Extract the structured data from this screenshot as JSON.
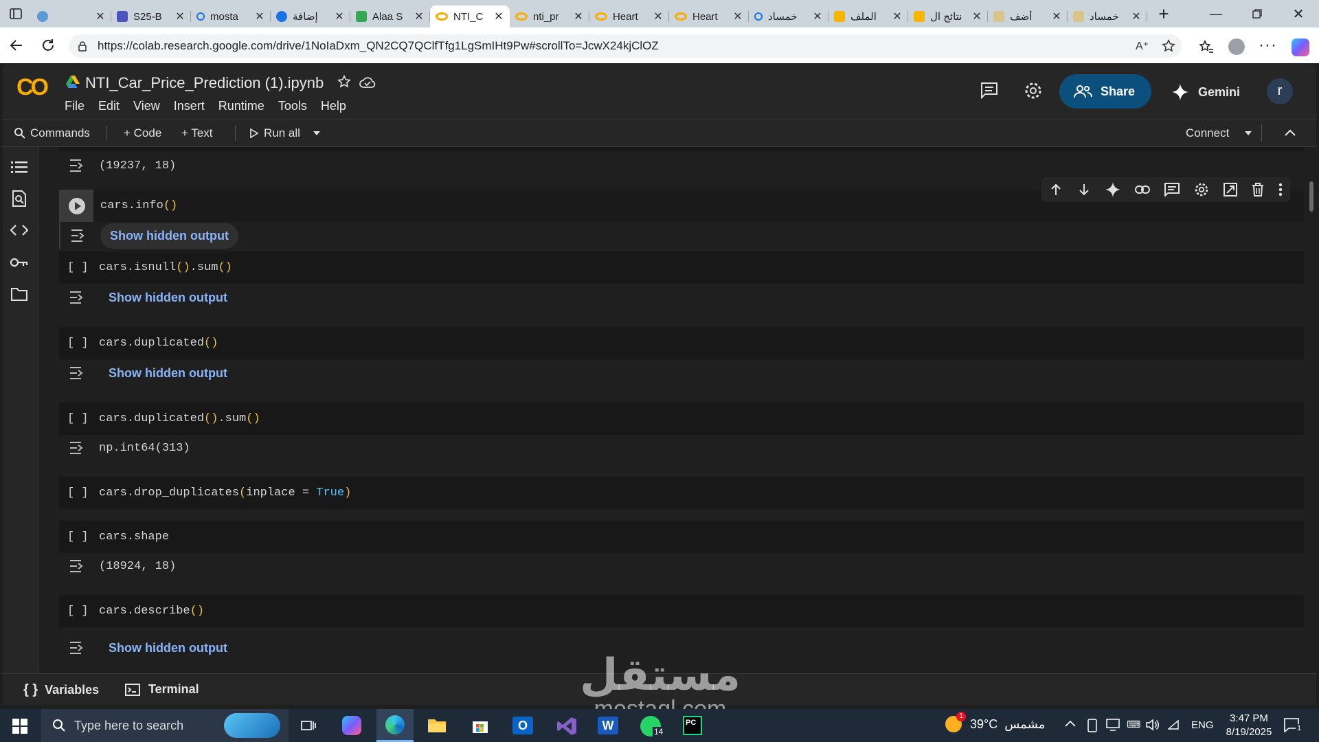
{
  "browser": {
    "tabs": [
      {
        "label": "",
        "favicon": "blue-circle-icon",
        "color": "#5b9bd5"
      },
      {
        "label": "S25-B",
        "favicon": "teams-icon",
        "color": "#4b53bc"
      },
      {
        "label": "mosta",
        "favicon": "search-icon",
        "color": "#1a73e8"
      },
      {
        "label": "إضافة",
        "favicon": "blue-circle-icon",
        "color": "#1a73e8"
      },
      {
        "label": "Alaa S",
        "favicon": "google-drive-icon",
        "color": "#34a853"
      },
      {
        "label": "NTI_C",
        "favicon": "colab-icon",
        "color": "#f9ab00",
        "active": true
      },
      {
        "label": "nti_pr",
        "favicon": "colab-icon",
        "color": "#f9ab00"
      },
      {
        "label": "Heart",
        "favicon": "colab-icon",
        "color": "#f9ab00"
      },
      {
        "label": "Heart",
        "favicon": "colab-icon",
        "color": "#f9ab00"
      },
      {
        "label": "خمساد",
        "favicon": "search-icon",
        "color": "#1a73e8"
      },
      {
        "label": "الملف",
        "favicon": "number-5-icon",
        "color": "#f6b500"
      },
      {
        "label": "نتائج ال",
        "favicon": "number-5-icon",
        "color": "#f6b500"
      },
      {
        "label": "أضف",
        "favicon": "number-5-icon",
        "color": "#d9c48a"
      },
      {
        "label": "خمساد",
        "favicon": "number-5-icon",
        "color": "#d9c48a"
      }
    ],
    "url": "https://colab.research.google.com/drive/1NoIaDxm_QN2CQ7QClfTfg1LgSmIHt9Pw#scrollTo=JcwX24kjClOZ"
  },
  "colab": {
    "logo": "CO",
    "notebook_title": "NTI_Car_Price_Prediction (1).ipynb",
    "menu": [
      "File",
      "Edit",
      "View",
      "Insert",
      "Runtime",
      "Tools",
      "Help"
    ],
    "share_label": "Share",
    "gemini_label": "Gemini",
    "avatar_letter": "r",
    "toolbar": {
      "commands": "Commands",
      "code": "+ Code",
      "text": "+ Text",
      "run_all": "Run all",
      "connect": "Connect"
    },
    "bottom": {
      "variables": "Variables",
      "terminal": "Terminal"
    },
    "colors": {
      "accent": "#8ab4f8",
      "share_bg": "#0b4f7c",
      "paren": "#f0c23b",
      "keyword": "#4fc1ff"
    }
  },
  "cells": {
    "c0_out": "(19237, 18)",
    "c1_code": "cars.info()",
    "c2_code": "cars.isnull().sum()",
    "c3_code": "cars.duplicated()",
    "c4_code": "cars.duplicated().sum()",
    "c4_out": "np.int64(313)",
    "c5_code": "cars.drop_duplicates(inplace = True)",
    "c6_code": "cars.shape",
    "c6_out": "(18924, 18)",
    "c7_code": "cars.describe()",
    "bracket": "[ ]",
    "show_hidden": "Show hidden output"
  },
  "watermark": {
    "arabic": "مستقل",
    "latin": "mostaql.com"
  },
  "taskbar": {
    "search_placeholder": "Type here to search",
    "weather": "39°C",
    "weather_text": "مشمس",
    "weather_badge": "1",
    "whatsapp_badge": "14",
    "lang": "ENG",
    "time": "3:47 PM",
    "date": "8/19/2025",
    "notif_count": "1"
  }
}
